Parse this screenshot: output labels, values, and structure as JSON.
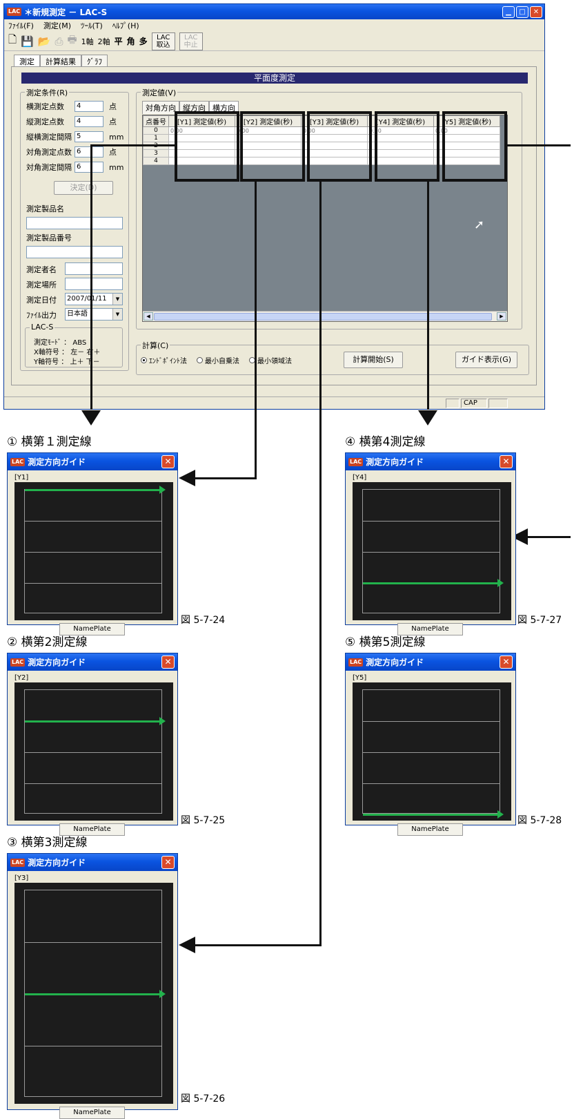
{
  "window": {
    "title": "＊新規測定 － LAC-S",
    "logo": "LAC",
    "menu": [
      "ﾌｧｲﾙ(F)",
      "測定(M)",
      "ﾂｰﾙ(T)",
      "ﾍﾙﾌﾟ(H)"
    ],
    "toolbar": {
      "axis1": "1軸",
      "axis2": "2軸",
      "flat": "平",
      "square": "角",
      "multi": "多",
      "lac_import": [
        "LAC",
        "取込"
      ],
      "lac_stop": [
        "LAC",
        "中止"
      ]
    },
    "tabs": [
      "測定",
      "計算結果",
      "ｸﾞﾗﾌ"
    ],
    "banner": "平面度測定"
  },
  "conditions": {
    "title": "測定条件(R)",
    "rows": [
      {
        "label": "横測定点数",
        "value": "4",
        "unit": "点"
      },
      {
        "label": "縦測定点数",
        "value": "4",
        "unit": "点"
      },
      {
        "label": "縦横測定間隔",
        "value": "5",
        "unit": "mm"
      },
      {
        "label": "対角測定点数",
        "value": "6",
        "unit": "点"
      },
      {
        "label": "対角測定間隔",
        "value": "6",
        "unit": "mm"
      }
    ],
    "decide_button": "決定(D)",
    "product_name_label": "測定製品名",
    "product_number_label": "測定製品番号",
    "operator_label": "測定者名",
    "place_label": "測定場所",
    "date_label": "測定日付",
    "date_value": "2007/01/11",
    "output_label": "ﾌｧｲﾙ出力",
    "output_value": "日本語",
    "lac_group": "LAC-S",
    "lac_lines": [
      "測定ﾓｰﾄﾞ ： ABS",
      "X軸符号 ： 左－ 右＋",
      "Y軸符号 ： 上＋ 下－"
    ]
  },
  "values": {
    "title": "測定値(V)",
    "subtabs": [
      "対角方向",
      "縦方向",
      "横方向"
    ],
    "row_header": "点番号",
    "columns": [
      "[Y1] 測定値(秒)",
      "[Y2] 測定値(秒)",
      "[Y3] 測定値(秒)",
      "[Y4] 測定値(秒)",
      "[Y5] 測定値(秒)"
    ],
    "row_numbers": [
      "0",
      "1",
      "2",
      "3",
      "4"
    ],
    "first_values": [
      "0.00",
      "0.00",
      "0.00",
      "0.00",
      "0.00"
    ]
  },
  "calc": {
    "title": "計算(C)",
    "options": [
      "ｴﾝﾄﾞﾎﾟｲﾝﾄ法",
      "最小自乗法",
      "最小領域法"
    ],
    "start_button": "計算開始(S)",
    "guide_button": "ガイド表示(G)"
  },
  "status": {
    "cap": "CAP"
  },
  "guides": [
    {
      "section": "① 横第１測定線",
      "title": "測定方向ガイド",
      "label": "[Y1]",
      "line_index": 0,
      "figure": "図 5-7-24",
      "nameplate": "NamePlate"
    },
    {
      "section": "② 横第2測定線",
      "title": "測定方向ガイド",
      "label": "[Y2]",
      "line_index": 1,
      "figure": "図 5-7-25",
      "nameplate": "NamePlate"
    },
    {
      "section": "③ 横第3測定線",
      "title": "測定方向ガイド",
      "label": "[Y3]",
      "line_index": 2,
      "figure": "図 5-7-26",
      "nameplate": "NamePlate"
    },
    {
      "section": "④ 横第4測定線",
      "title": "測定方向ガイド",
      "label": "[Y4]",
      "line_index": 3,
      "figure": "図 5-7-27",
      "nameplate": "NamePlate"
    },
    {
      "section": "⑤ 横第5測定線",
      "title": "測定方向ガイド",
      "label": "[Y5]",
      "line_index": 4,
      "figure": "図 5-7-28",
      "nameplate": "NamePlate"
    }
  ],
  "colors": {
    "arrow": "#22b24c",
    "banner": "#28286f",
    "titlebar": "#0a54e0"
  }
}
